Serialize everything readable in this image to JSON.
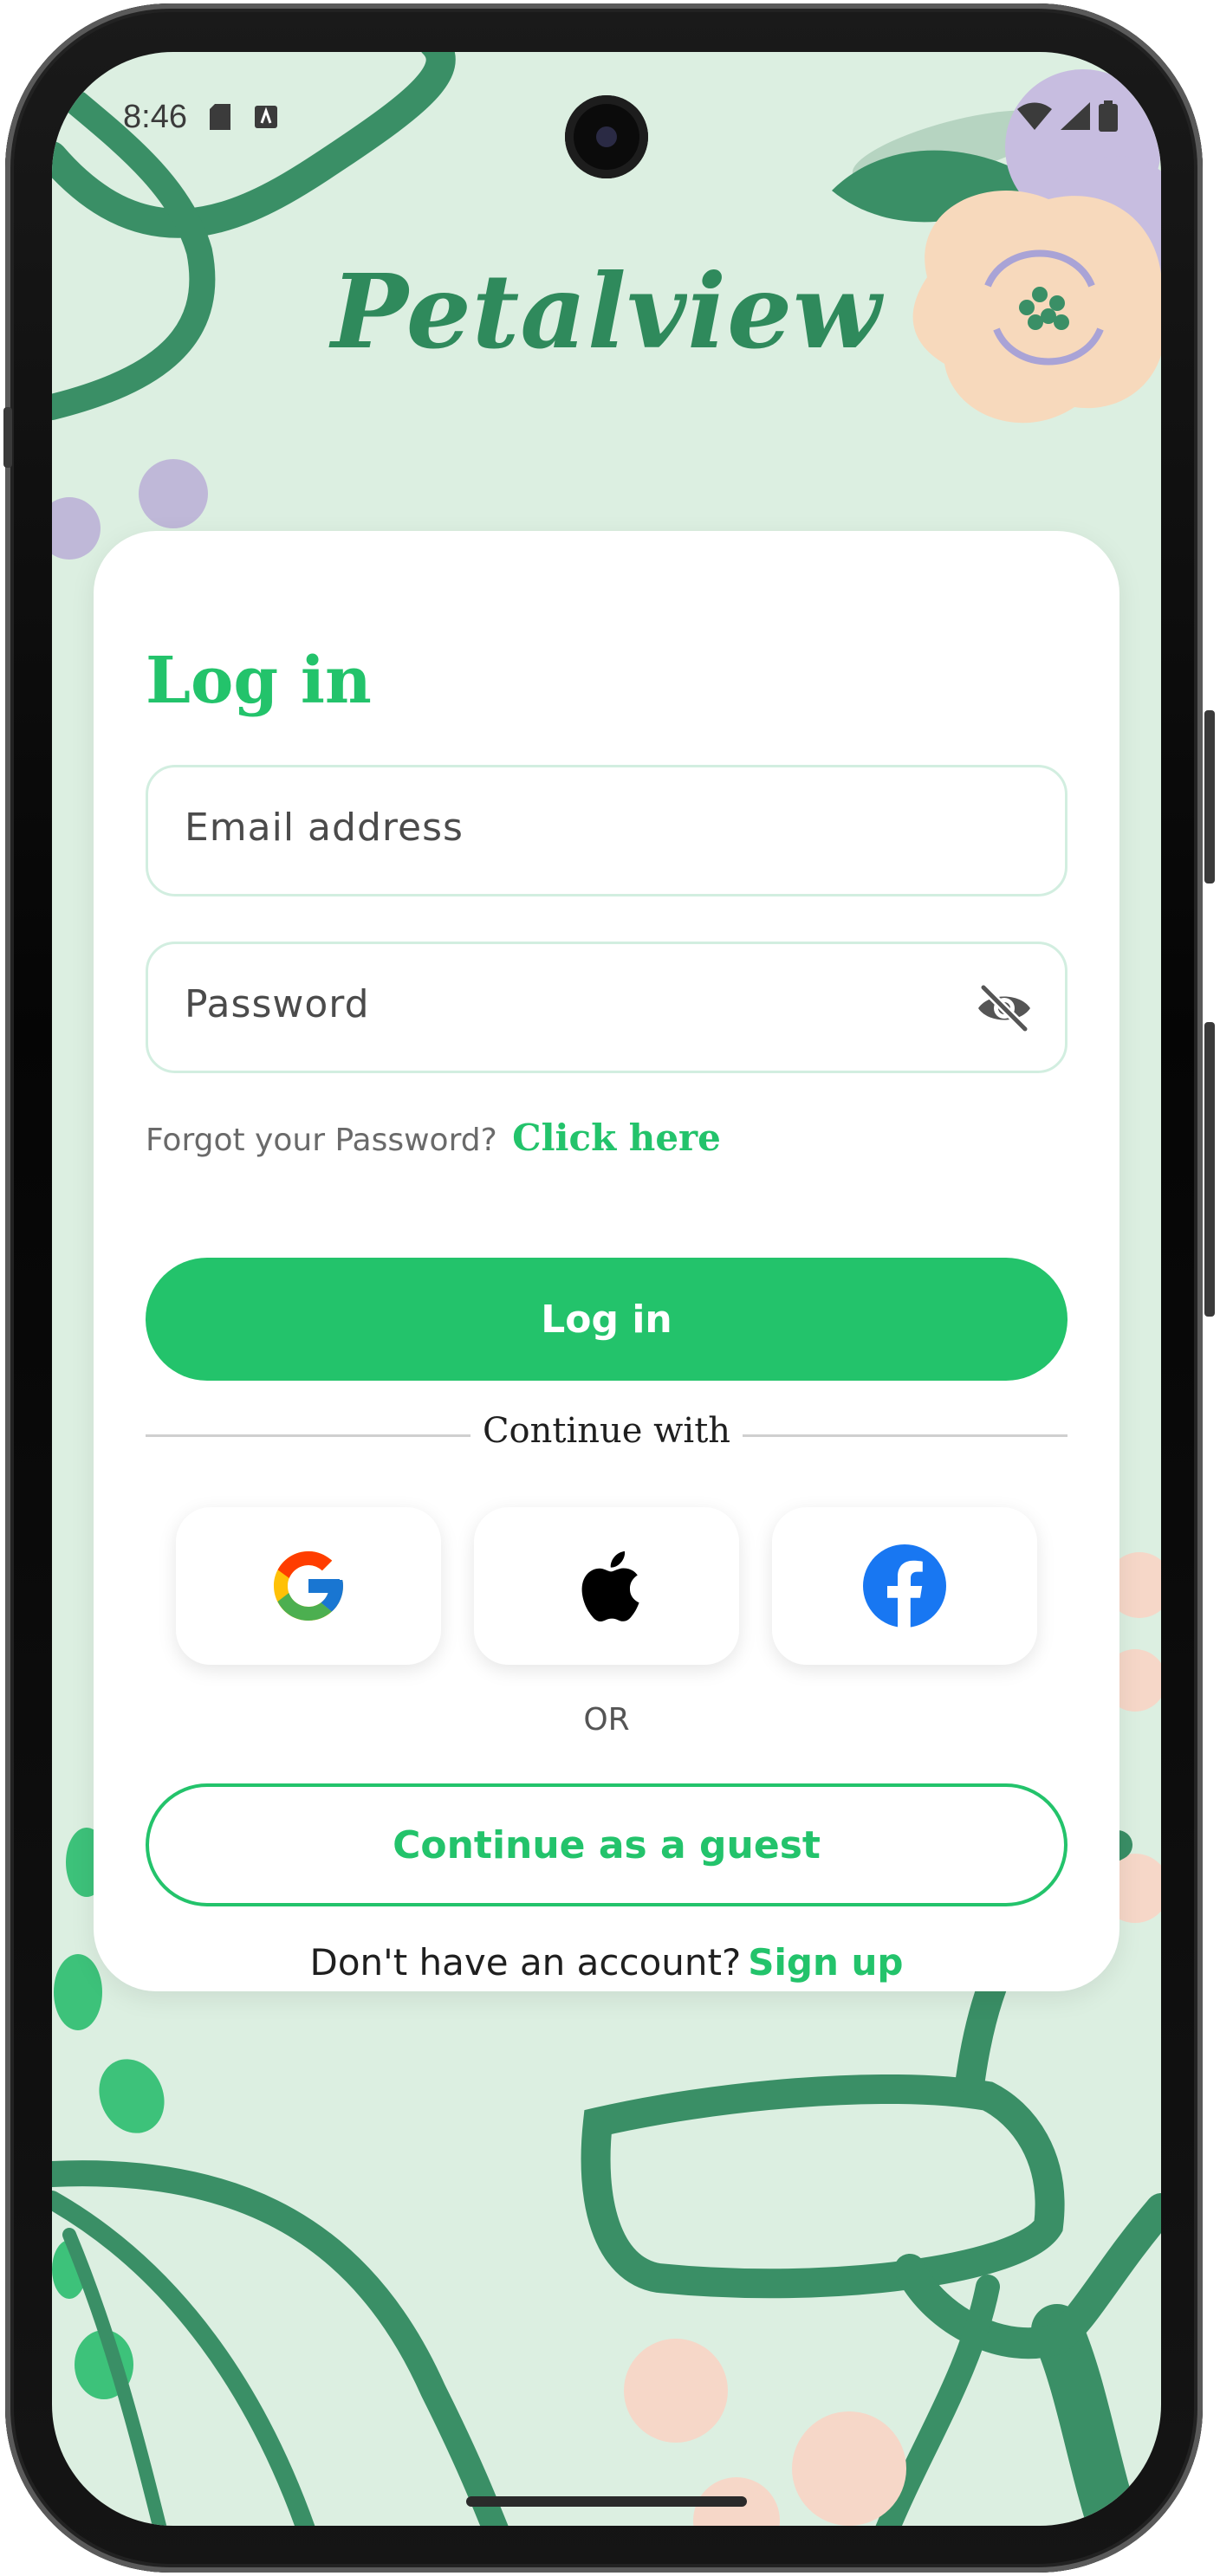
{
  "status_bar": {
    "time": "8:46"
  },
  "app": {
    "logo": "Petalview"
  },
  "login_card": {
    "title": "Log in",
    "email_placeholder": "Email address",
    "password_placeholder": "Password",
    "forgot_text": "Forgot your Password?",
    "forgot_link": "Click here",
    "login_button": "Log in",
    "continue_with": "Continue with",
    "social": [
      {
        "name": "google-icon"
      },
      {
        "name": "apple-icon"
      },
      {
        "name": "facebook-icon"
      }
    ],
    "or_text": "OR",
    "guest_button": "Continue as a guest",
    "signup_prompt": "Don't have an account?",
    "signup_link": "Sign up"
  },
  "colors": {
    "accent": "#23c36b",
    "logo": "#2f8a5c",
    "background": "#dcefe1",
    "vine": "#3a8f66"
  }
}
